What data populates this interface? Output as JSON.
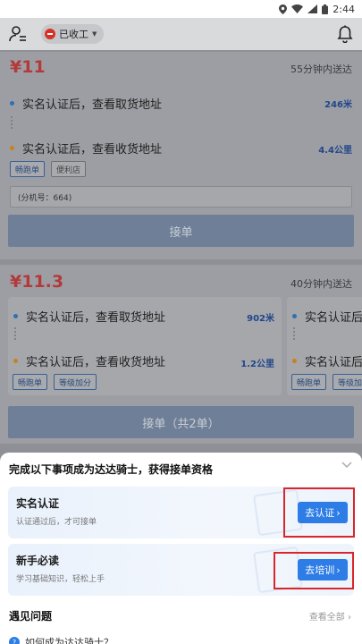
{
  "status_bar": {
    "time": "2:44"
  },
  "header": {
    "status_label": "已收工"
  },
  "order1": {
    "price": "¥11",
    "eta": "55分钟内送达",
    "pickup": {
      "text": "实名认证后，查看取货地址",
      "distance": "246米"
    },
    "dropoff": {
      "text": "实名认证后，查看收货地址",
      "distance": "4.4公里"
    },
    "tags": [
      "畅跑单",
      "便利店"
    ],
    "note": "(分机号：664)",
    "accept_label": "接单"
  },
  "order2": {
    "price": "¥11.3",
    "eta": "40分钟内送达",
    "sub_a": {
      "pickup": {
        "text": "实名认证后，查看取货地址",
        "distance": "902米"
      },
      "dropoff": {
        "text": "实名认证后，查看收货地址",
        "distance": "1.2公里"
      },
      "tags": [
        "畅跑单",
        "等级加分"
      ]
    },
    "sub_b": {
      "pickup": {
        "text": "实名认证后"
      },
      "dropoff": {
        "text": "实名认证后"
      },
      "tags": [
        "畅跑单",
        "等级加"
      ]
    },
    "accept_label": "接单（共2单）"
  },
  "sheet": {
    "title": "完成以下事项成为达达骑士，获得接单资格",
    "items": [
      {
        "title": "实名认证",
        "subtitle": "认证通过后，才可接单",
        "button": "去认证"
      },
      {
        "title": "新手必读",
        "subtitle": "学习基础知识，轻松上手",
        "button": "去培训"
      }
    ],
    "faq_title": "遇见问题",
    "faq_all": "查看全部",
    "faq_first": "如何成为达达骑士？"
  },
  "colors": {
    "price_red": "#b23a3a",
    "primary_blue": "#2e7de6",
    "highlight_red": "#d8262c"
  }
}
